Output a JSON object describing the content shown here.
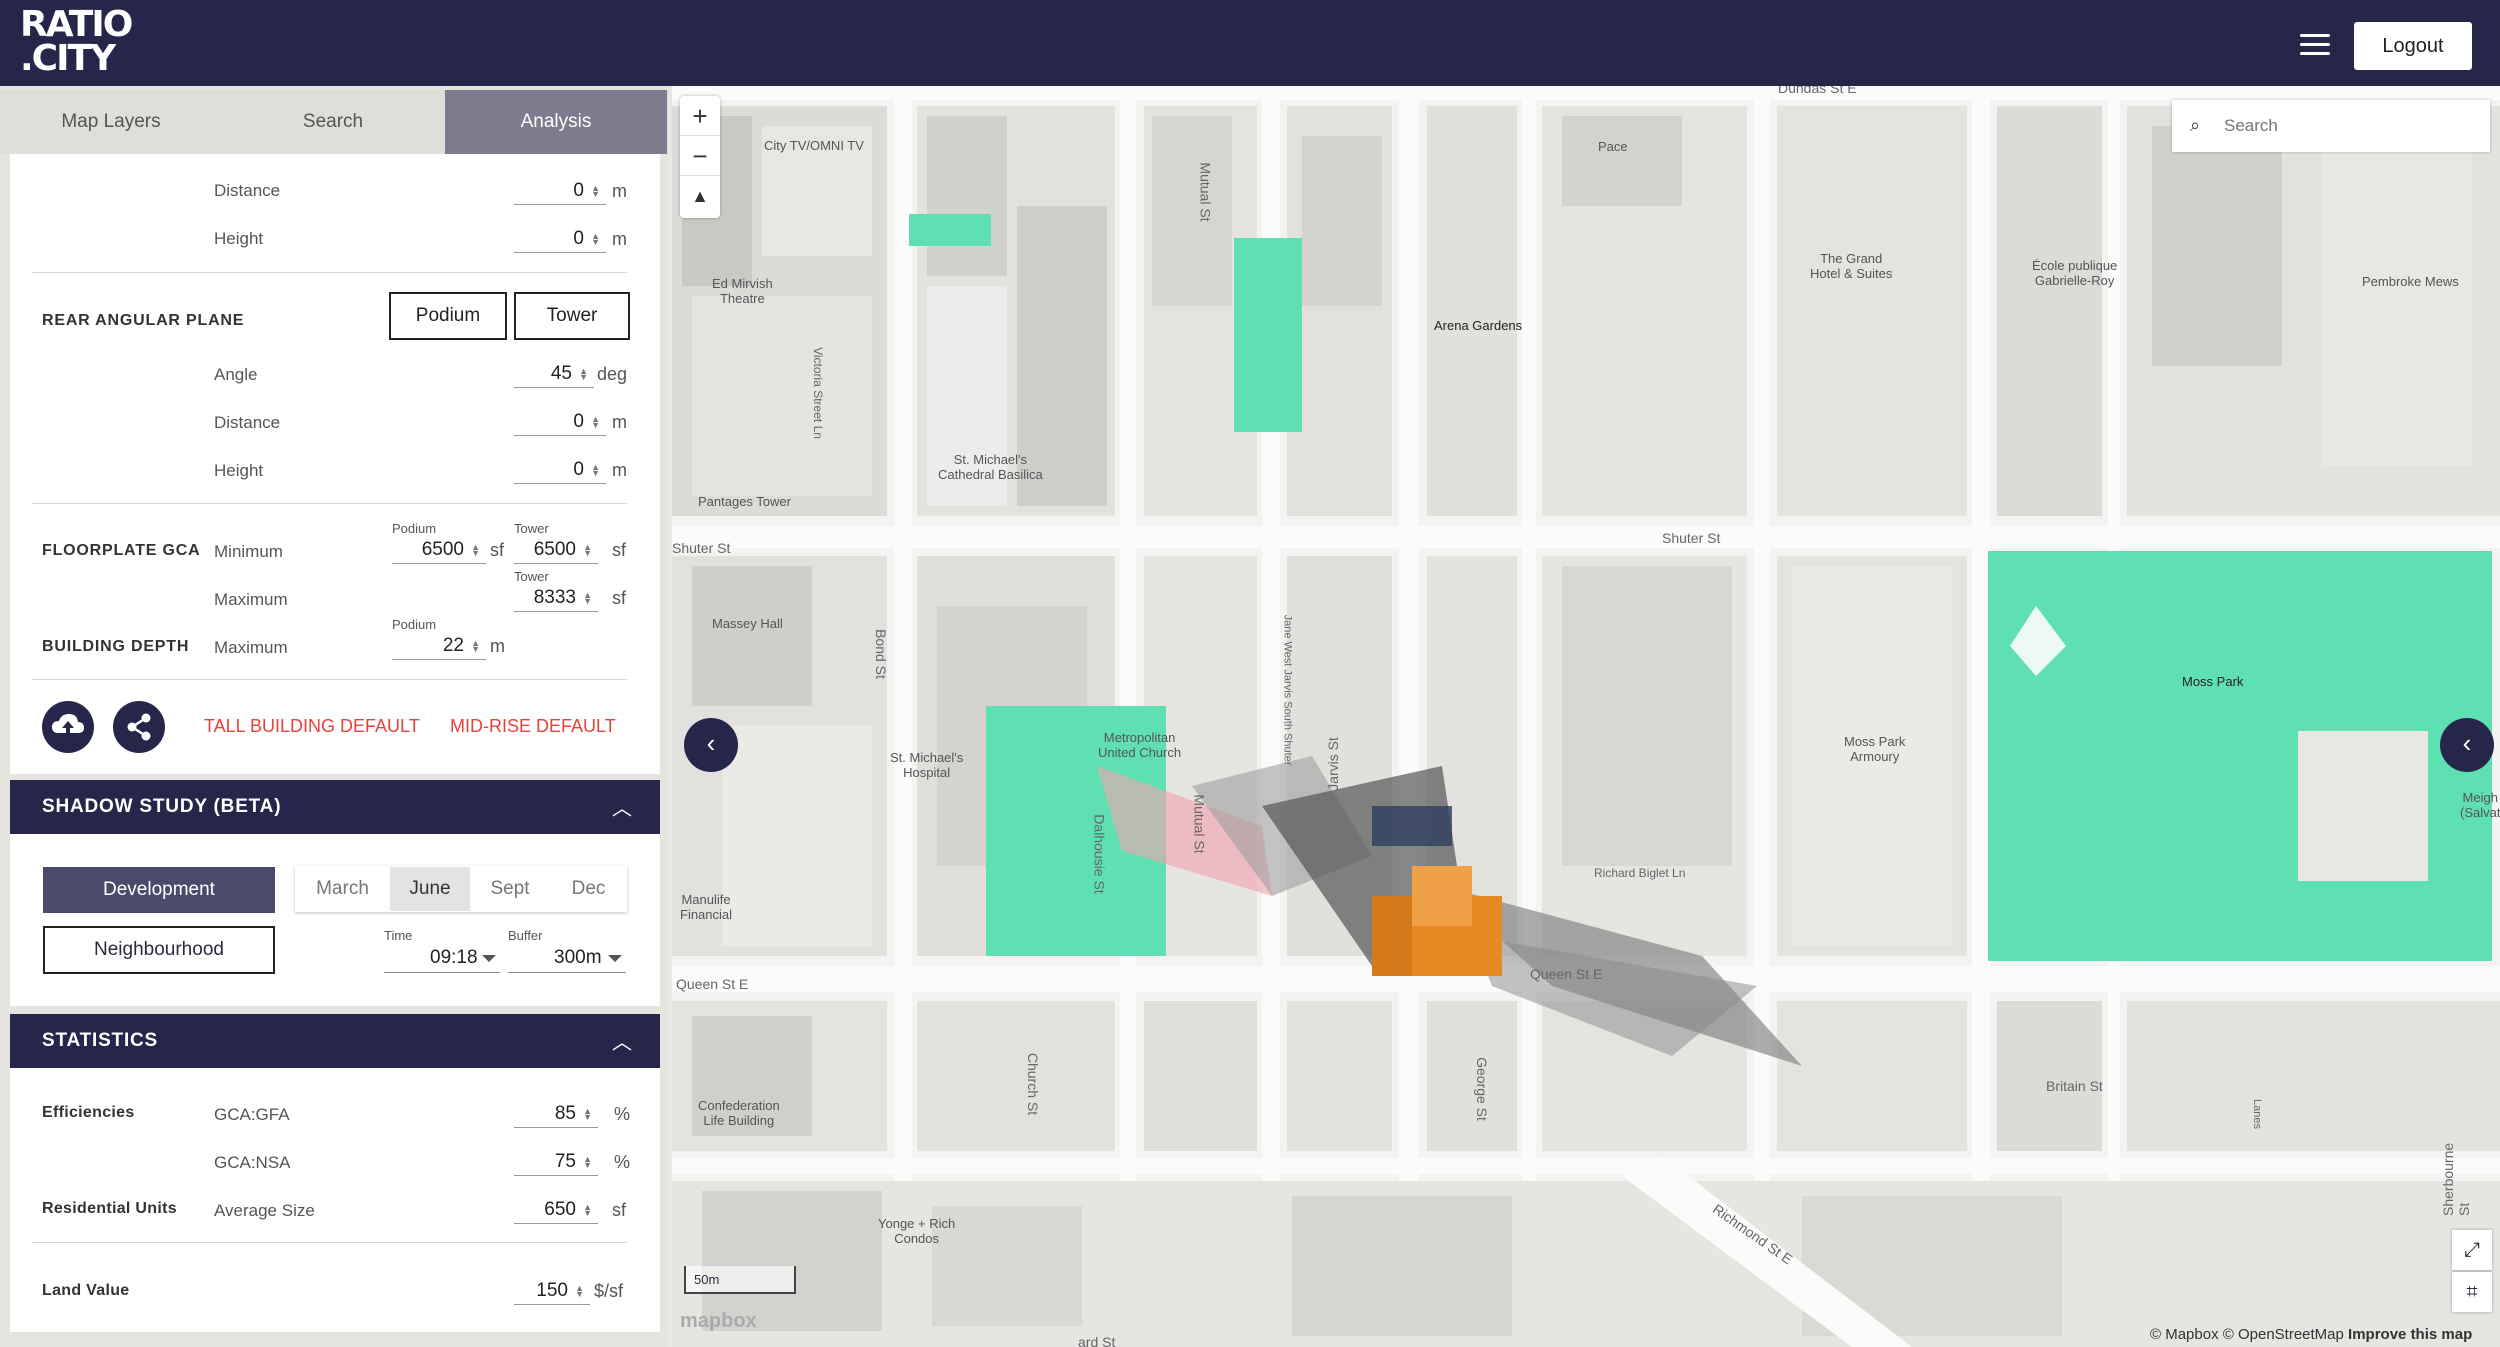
{
  "app": {
    "logo_line1": "RATIO",
    "logo_line2": ".CITY",
    "logout_label": "Logout"
  },
  "tabs": [
    {
      "label": "Map Layers"
    },
    {
      "label": "Search"
    },
    {
      "label": "Analysis"
    }
  ],
  "setback": {
    "distance": {
      "label": "Distance",
      "value": "0",
      "unit": "m"
    },
    "height": {
      "label": "Height",
      "value": "0",
      "unit": "m"
    }
  },
  "rear_angular_plane": {
    "title": "REAR ANGULAR PLANE",
    "podium_btn": "Podium",
    "tower_btn": "Tower",
    "angle": {
      "label": "Angle",
      "value": "45",
      "unit": "deg"
    },
    "distance": {
      "label": "Distance",
      "value": "0",
      "unit": "m"
    },
    "height": {
      "label": "Height",
      "value": "0",
      "unit": "m"
    }
  },
  "floorplate": {
    "title": "FLOORPLATE GCA",
    "min_label": "Minimum",
    "max_label": "Maximum",
    "podium_label": "Podium",
    "tower_label": "Tower",
    "tower_label2": "Tower",
    "min_podium": "6500",
    "min_tower": "6500",
    "max_tower": "8333",
    "unit": "sf"
  },
  "building_depth": {
    "title": "BUILDING DEPTH",
    "max_label": "Maximum",
    "podium_label": "Podium",
    "value": "22",
    "unit": "m"
  },
  "defaults": {
    "tall": "TALL BUILDING DEFAULT",
    "midrise": "MID-RISE DEFAULT"
  },
  "shadow_study": {
    "title": "SHADOW STUDY (BETA)",
    "development": "Development",
    "neighbourhood": "Neighbourhood",
    "seasons": [
      "March",
      "June",
      "Sept",
      "Dec"
    ],
    "selected_season": "June",
    "time_label": "Time",
    "time_value": "09:18",
    "buffer_label": "Buffer",
    "buffer_value": "300m"
  },
  "statistics": {
    "title": "STATISTICS",
    "efficiencies_label": "Efficiencies",
    "gca_gfa": {
      "label": "GCA:GFA",
      "value": "85",
      "unit": "%"
    },
    "gca_nsa": {
      "label": "GCA:NSA",
      "value": "75",
      "unit": "%"
    },
    "residential_label": "Residential Units",
    "avg_size": {
      "label": "Average Size",
      "value": "650",
      "unit": "sf"
    },
    "land_value_label": "Land Value",
    "land_value": {
      "value": "150",
      "unit": "$/sf"
    }
  },
  "map": {
    "search_placeholder": "Search",
    "zoom_in": "+",
    "zoom_out": "−",
    "compass": "▲",
    "scale_label": "50m",
    "logo": "mapbox",
    "attribution": "© Mapbox © OpenStreetMap",
    "improve": "Improve this map",
    "places": {
      "city_tv": "City TV/OMNI TV",
      "ed_mirvish": "Ed Mirvish\nTheatre",
      "arena_gardens": "Arena Gardens",
      "st_michaels_cathedral": "St. Michael's\nCathedral Basilica",
      "grand_hotel": "The Grand\nHotel & Suites",
      "ecole": "École publique\nGabrielle-Roy",
      "pembroke_mews": "Pembroke Mews",
      "pantages": "Pantages Tower",
      "massey_hall": "Massey Hall",
      "metropolitan": "Metropolitan\nUnited Church",
      "st_michaels_hospital": "St. Michael's\nHospital",
      "moss_park": "Moss Park",
      "moss_park_armoury": "Moss Park\nArmoury",
      "manulife": "Manulife\nFinancial",
      "confederation": "Confederation\nLife Building",
      "yonge_rich": "Yonge + Rich\nCondos",
      "pace": "Pace",
      "meigh": "Meigh\n(Salvat"
    },
    "streets": {
      "dundas": "Dundas St E",
      "shuter_e": "Shuter St",
      "shuter_w": "Shuter St",
      "queen_w": "Queen St E",
      "queen_e": "Queen St E",
      "richard_biglet": "Richard Biglet Ln",
      "britain": "Britain St",
      "richmond": "Richmond St E",
      "dalhousie": "Dalhousie St",
      "mutual": "Mutual St",
      "mutual2": "Mutual St",
      "bond": "Bond St",
      "church": "Church St",
      "jarvis": "Jarvis St",
      "george": "George St",
      "victoria": "Victoria Street Ln",
      "sherbourne": "Sherbourne St",
      "jarvis_south": "Jane West Jarvis South Shuter",
      "adelaide": "ard St",
      "lanes": "Lanes"
    }
  }
}
